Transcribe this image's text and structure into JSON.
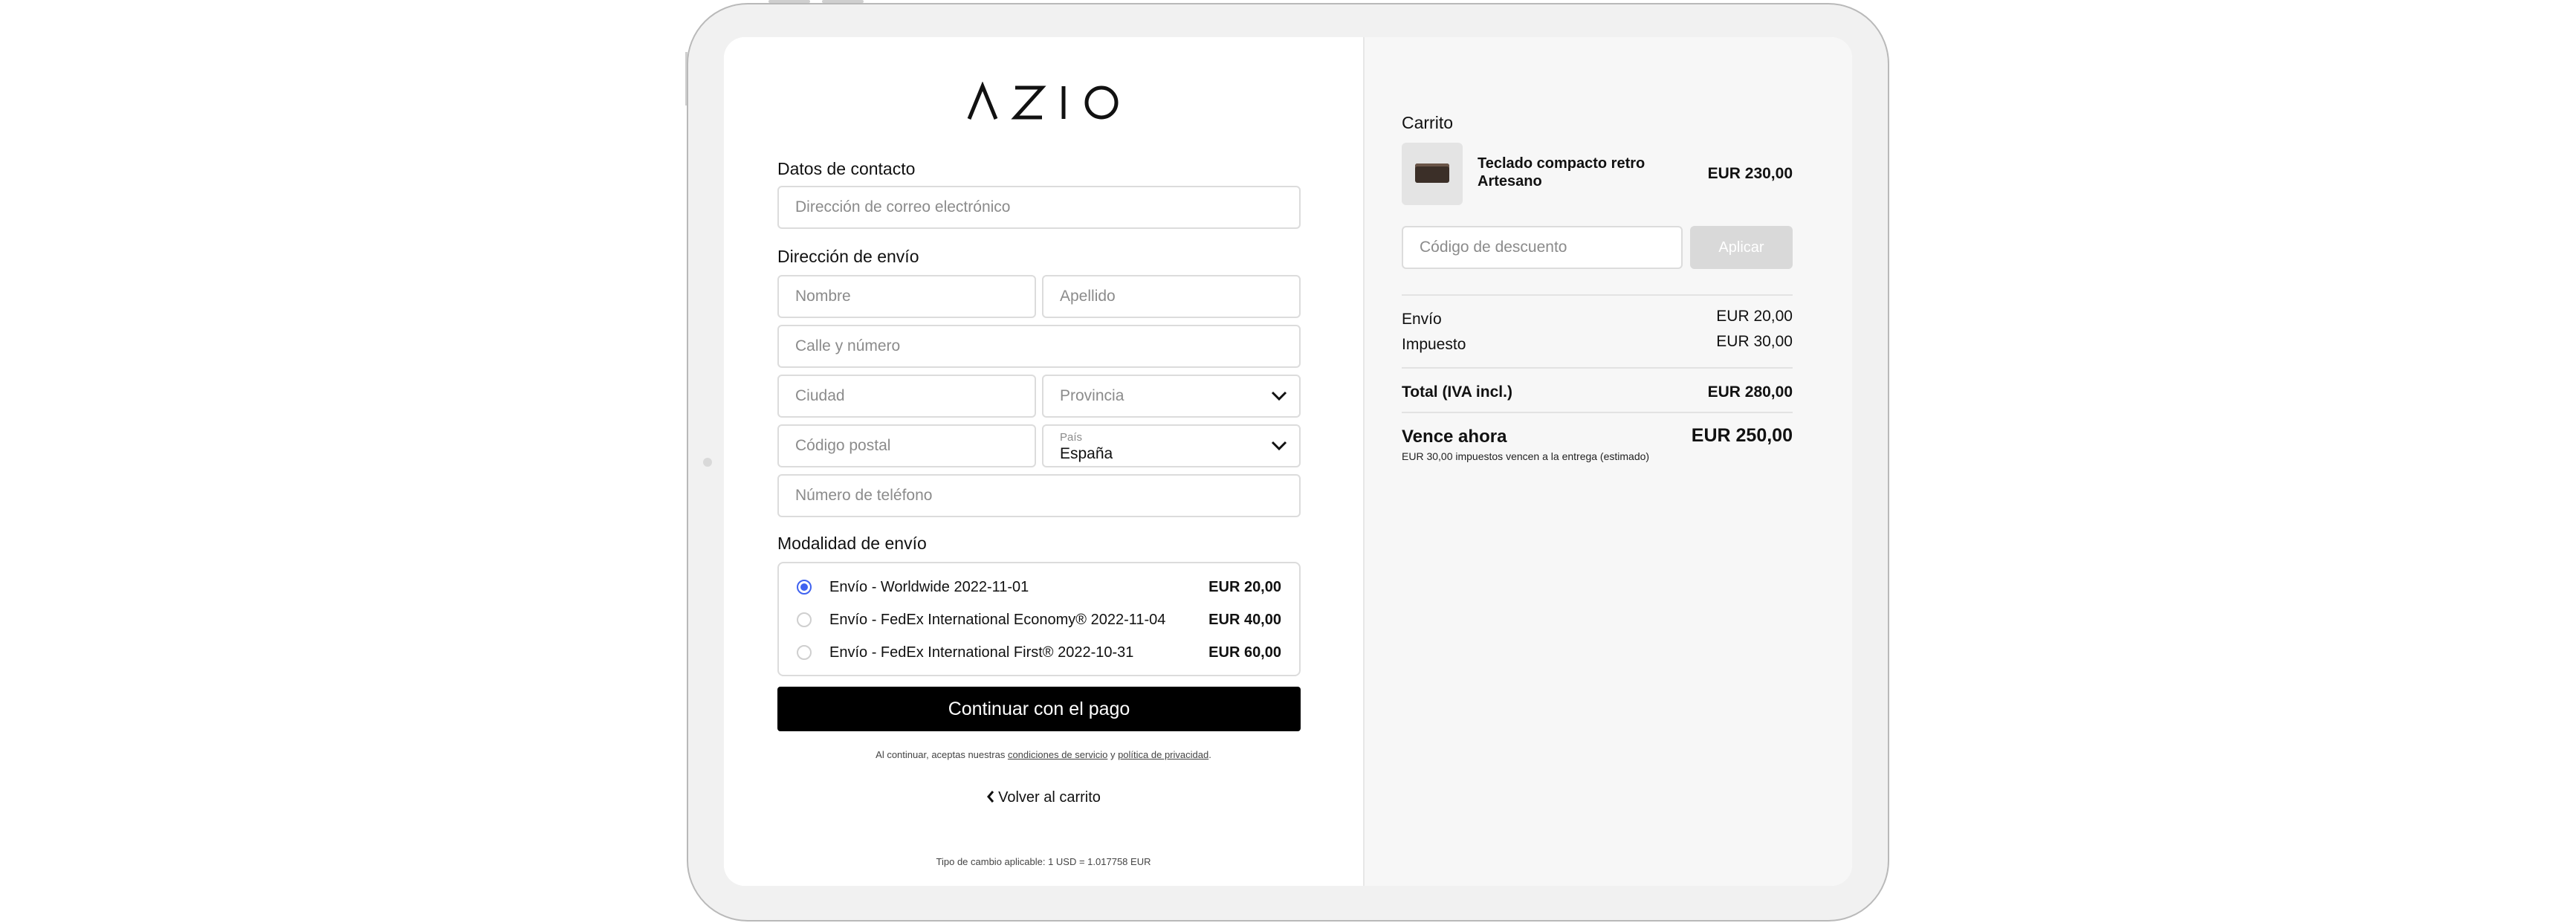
{
  "brand": {
    "logo_text": "AZIO"
  },
  "contact": {
    "title": "Datos de contacto",
    "email_placeholder": "Dirección de correo electrónico"
  },
  "shipping_address": {
    "title": "Dirección de envío",
    "first_name_placeholder": "Nombre",
    "last_name_placeholder": "Apellido",
    "street_placeholder": "Calle y número",
    "city_placeholder": "Ciudad",
    "province_placeholder": "Provincia",
    "postal_placeholder": "Código postal",
    "country_label": "País",
    "country_value": "España",
    "phone_placeholder": "Número de teléfono"
  },
  "shipping_method": {
    "title": "Modalidad de envío",
    "options": [
      {
        "label": "Envío - Worldwide 2022-11-01",
        "price": "EUR 20,00",
        "selected": true
      },
      {
        "label": "Envío - FedEx International Economy® 2022-11-04",
        "price": "EUR 40,00",
        "selected": false
      },
      {
        "label": "Envío - FedEx International First® 2022-10-31",
        "price": "EUR 60,00",
        "selected": false
      }
    ]
  },
  "actions": {
    "continue_label": "Continuar con el pago",
    "terms_prefix": "Al continuar, aceptas nuestras ",
    "terms_link": "condiciones de servicio",
    "terms_mid": " y ",
    "privacy_link": "política de privacidad",
    "terms_suffix": ".",
    "back_label": "Volver al carrito",
    "exchange_rate": "Tipo de cambio aplicable: 1 USD = 1.017758 EUR"
  },
  "cart": {
    "title": "Carrito",
    "item": {
      "name": "Teclado compacto retro Artesano",
      "price": "EUR 230,00"
    },
    "discount_placeholder": "Código de descuento",
    "apply_label": "Aplicar",
    "shipping_label": "Envío",
    "shipping_value": "EUR 20,00",
    "tax_label": "Impuesto",
    "tax_value": "EUR 30,00",
    "total_label": "Total (IVA incl.)",
    "total_value": "EUR 280,00",
    "due_label": "Vence ahora",
    "due_value": "EUR 250,00",
    "due_note": "EUR 30,00 impuestos vencen a la entrega (estimado)"
  },
  "colors": {
    "accent": "#3f62f0",
    "primary_button": "#000000",
    "apply_disabled": "#d9d9d9"
  }
}
